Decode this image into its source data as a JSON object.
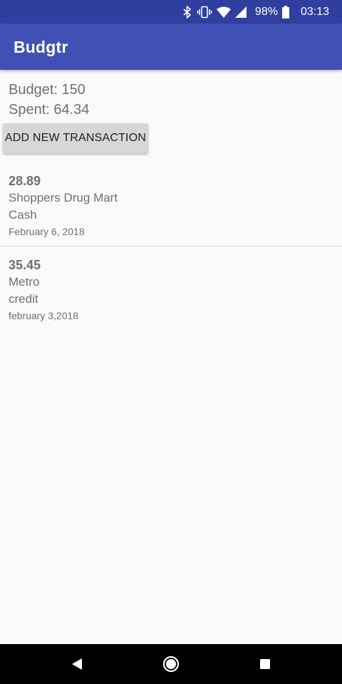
{
  "status_bar": {
    "battery": "98%",
    "time": "03:13",
    "icons": [
      "bluetooth-icon",
      "vibrate-icon",
      "wifi-icon",
      "signal-icon",
      "battery-icon"
    ]
  },
  "app_bar": {
    "title": "Budgtr"
  },
  "summary": {
    "budget": "Budget: 150",
    "spent": "Spent: 64.34"
  },
  "actions": {
    "add_label": "ADD NEW TRANSACTION"
  },
  "transactions": [
    {
      "amount": "28.89",
      "store": "Shoppers Drug Mart",
      "method": "Cash",
      "date": "February 6, 2018"
    },
    {
      "amount": "35.45",
      "store": "Metro",
      "method": "credit",
      "date": "february 3,2018"
    }
  ],
  "nav": {
    "icons": [
      "back-icon",
      "home-icon",
      "recents-icon"
    ]
  },
  "colors": {
    "status_bar": "#303f9f",
    "app_bar": "#3f51b5",
    "background": "#fafafa",
    "button": "#d6d7d7",
    "text": "#707070"
  }
}
